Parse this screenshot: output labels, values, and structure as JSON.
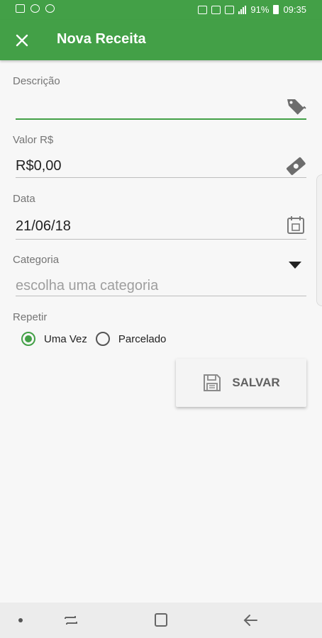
{
  "status_bar": {
    "battery": "91%",
    "time": "09:35"
  },
  "app_bar": {
    "title": "Nova Receita"
  },
  "form": {
    "descricao": {
      "label": "Descrição",
      "value": ""
    },
    "valor": {
      "label": "Valor R$",
      "value": "R$0,00"
    },
    "data": {
      "label": "Data",
      "value": "21/06/18"
    },
    "categoria": {
      "label": "Categoria",
      "placeholder": "escolha uma categoria"
    },
    "repetir": {
      "label": "Repetir",
      "options": [
        {
          "label": "Uma Vez",
          "selected": true
        },
        {
          "label": "Parcelado",
          "selected": false
        }
      ]
    }
  },
  "save_button": {
    "label": "SALVAR"
  },
  "colors": {
    "primary": "#43a047",
    "background": "#f7f7f7"
  }
}
